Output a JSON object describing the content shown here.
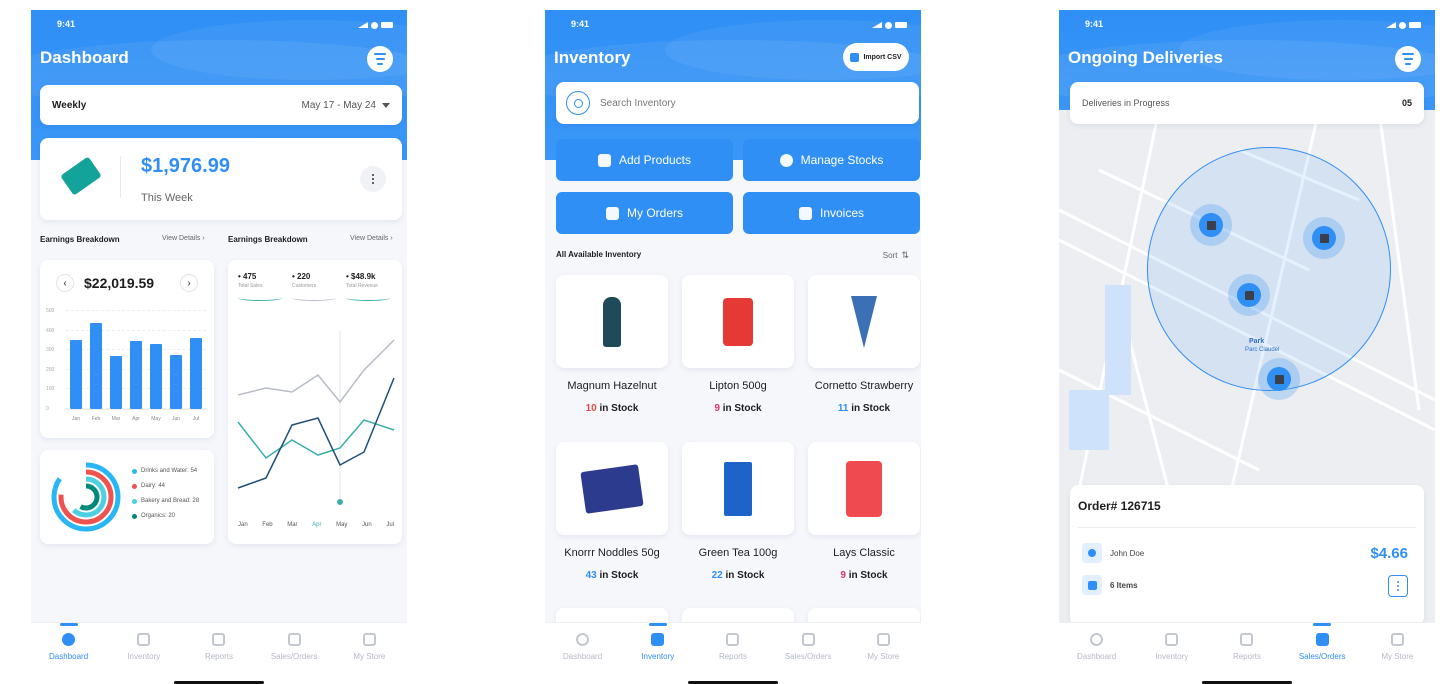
{
  "status_time": "9:41",
  "tabs": [
    "Dashboard",
    "Inventory",
    "Reports",
    "Sales/Orders",
    "My Store"
  ],
  "dashboard": {
    "title": "Dashboard",
    "period_label": "Weekly",
    "date_range": "May 17 - May 24",
    "earnings_amount": "$1,976.99",
    "earnings_sub": "This Week",
    "breakdown_left_title": "Earnings Breakdown",
    "breakdown_right_title": "Earnings Breakdown",
    "view_details": "View Details",
    "bar_total": "$22,019.59",
    "stats": [
      {
        "value": "475",
        "label": "Total Sales"
      },
      {
        "value": "220",
        "label": "Customers"
      },
      {
        "value": "$48.9k",
        "label": "Total Revenue"
      }
    ],
    "legend": [
      {
        "label": "Drinks and Water: 54",
        "color": "#29b6f6"
      },
      {
        "label": "Dairy: 44",
        "color": "#ef5350"
      },
      {
        "label": "Bakery and Bread: 28",
        "color": "#4dd0e1"
      },
      {
        "label": "Organics: 20",
        "color": "#00897b"
      }
    ],
    "bar_chart": {
      "type": "bar",
      "categories": [
        "Jan",
        "Feb",
        "Mar",
        "Apr",
        "May",
        "Jun",
        "Jul"
      ],
      "values": [
        350,
        440,
        270,
        345,
        330,
        275,
        360
      ],
      "ylim": [
        0,
        500
      ],
      "yticks": [
        "0",
        "100",
        "200",
        "300",
        "400",
        "500"
      ]
    },
    "line_chart": {
      "type": "line",
      "categories": [
        "Jan",
        "Feb",
        "Mar",
        "Apr",
        "May",
        "Jun",
        "Jul"
      ]
    }
  },
  "inventory": {
    "title": "Inventory",
    "import_label": "Import CSV",
    "search_placeholder": "Search Inventory",
    "actions": [
      "Add Products",
      "Manage Stocks",
      "My Orders",
      "Invoices"
    ],
    "section_title": "All Available Inventory",
    "sort_label": "Sort",
    "stock_suffix": "in Stock",
    "products": [
      {
        "name": "Magnum Hazelnut",
        "stock": "10",
        "color": "n-red"
      },
      {
        "name": "Lipton 500g",
        "stock": "9",
        "color": "n-pink"
      },
      {
        "name": "Cornetto Strawberry",
        "stock": "11",
        "color": "n-blue"
      },
      {
        "name": "Knorrr Noddles 50g",
        "stock": "43",
        "color": "n-blue"
      },
      {
        "name": "Green Tea 100g",
        "stock": "22",
        "color": "n-blue"
      },
      {
        "name": "Lays Classic",
        "stock": "9",
        "color": "n-pink"
      }
    ]
  },
  "deliveries": {
    "title": "Ongoing Deliveries",
    "progress_label": "Deliveries in Progress",
    "progress_count": "05",
    "map_park": "Park",
    "map_park_sub": "Parc Claudel",
    "order_number": "Order# 126715",
    "customer": "John Doe",
    "items": "6 Items",
    "total": "$4.66"
  }
}
